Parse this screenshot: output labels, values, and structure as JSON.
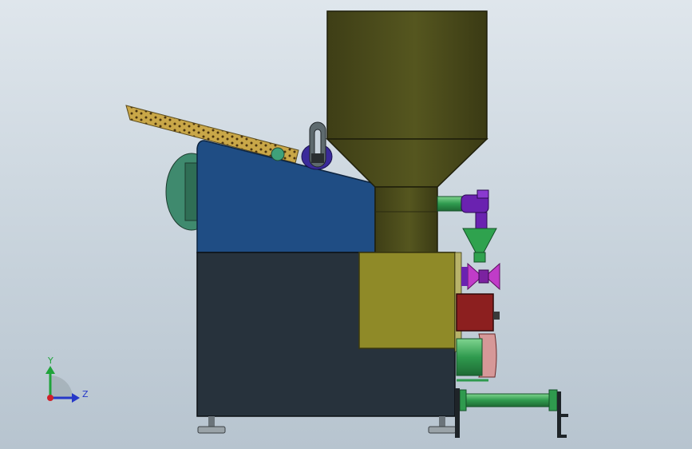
{
  "view": {
    "background_top": "#dfe6ec",
    "background_bottom": "#b7c4cf"
  },
  "triad": {
    "y_label": "Y",
    "z_label": "Z",
    "y_color": "#1fa33a",
    "z_color": "#2638c8",
    "x_color": "#d0202a"
  },
  "colors": {
    "hopper": "#4a4a1c",
    "frame_upper": "#1f4d84",
    "frame_lower": "#27323c",
    "feed_box": "#8f8a28",
    "motor_disc": "#3f8a6e",
    "conveyor": "#b89a40",
    "pipe_green": "#39a35a",
    "valve_purple": "#6a22b0",
    "valve_pink": "#c03cc8",
    "red_block": "#8c1f1f",
    "salmon_part": "#d69898"
  }
}
